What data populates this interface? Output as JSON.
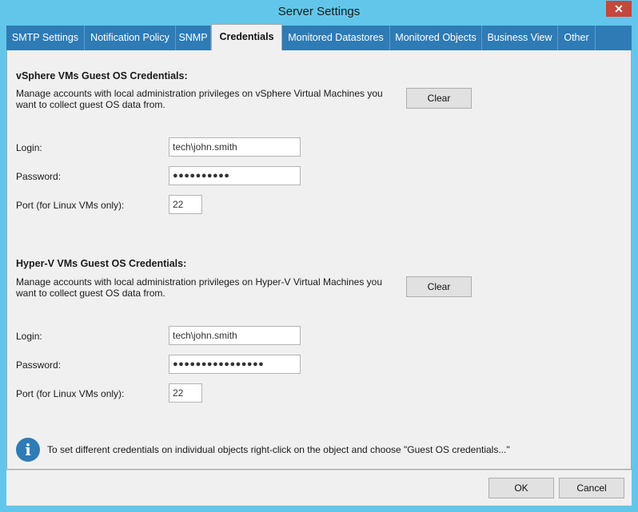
{
  "window": {
    "title": "Server Settings",
    "close_glyph": "✕"
  },
  "tabs": [
    {
      "label": "SMTP Settings"
    },
    {
      "label": "Notification Policy"
    },
    {
      "label": "SNMP"
    },
    {
      "label": "Credentials"
    },
    {
      "label": "Monitored Datastores"
    },
    {
      "label": "Monitored Objects"
    },
    {
      "label": "Business View"
    },
    {
      "label": "Other"
    }
  ],
  "active_tab": "Credentials",
  "vsphere": {
    "heading": "vSphere VMs Guest OS Credentials:",
    "description": "Manage accounts with local administration privileges on vSphere Virtual Machines you want to collect guest OS data from.",
    "clear_label": "Clear",
    "login_label": "Login:",
    "login_value": "tech\\john.smith",
    "password_label": "Password:",
    "password_value": "●●●●●●●●●●",
    "port_label": "Port (for Linux VMs only):",
    "port_value": "22"
  },
  "hyperv": {
    "heading": "Hyper-V VMs Guest OS Credentials:",
    "description": "Manage accounts with local administration privileges on Hyper-V Virtual Machines you want to collect guest OS data from.",
    "clear_label": "Clear",
    "login_label": "Login:",
    "login_value": "tech\\john.smith",
    "password_label": "Password:",
    "password_value": "●●●●●●●●●●●●●●●●",
    "port_label": "Port (for Linux VMs only):",
    "port_value": "22"
  },
  "info": {
    "icon": "i",
    "text": "To set different credentials on individual objects right-click on the object and choose \"Guest OS credentials...\""
  },
  "footer": {
    "ok_label": "OK",
    "cancel_label": "Cancel"
  },
  "colors": {
    "chrome": "#62c6ea",
    "tab_bar": "#2e7bb5",
    "close": "#c7463d",
    "panel": "#f0f0f0"
  }
}
